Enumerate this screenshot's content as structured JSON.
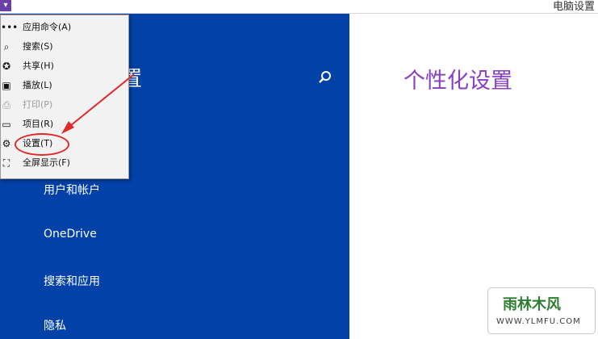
{
  "window": {
    "title": "电脑设置"
  },
  "left_pane": {
    "heading": "置",
    "items": [
      {
        "label": "用户和帐户"
      },
      {
        "label": "OneDrive"
      },
      {
        "label": "搜索和应用"
      },
      {
        "label": "隐私"
      }
    ]
  },
  "main": {
    "page_title": "个性化设置"
  },
  "context_menu": {
    "items": [
      {
        "label": "应用命令(A)",
        "icon": "more-icon",
        "enabled": true
      },
      {
        "label": "搜索(S)",
        "icon": "search-icon",
        "enabled": true
      },
      {
        "label": "共享(H)",
        "icon": "share-icon",
        "enabled": true
      },
      {
        "label": "播放(L)",
        "icon": "play-icon",
        "enabled": true
      },
      {
        "label": "打印(P)",
        "icon": "print-icon",
        "enabled": false
      },
      {
        "label": "项目(R)",
        "icon": "project-icon",
        "enabled": true
      },
      {
        "label": "设置(T)",
        "icon": "gear-icon",
        "enabled": true,
        "highlighted": true
      },
      {
        "label": "全屏显示(F)",
        "icon": "fullscreen-icon",
        "enabled": true
      }
    ]
  },
  "watermark": {
    "logo": "雨林木风",
    "url": "WWW.YLMFU.COM"
  },
  "colors": {
    "pane_blue": "#0242a8",
    "title_purple": "#8a3ec2",
    "annotation_red": "#e02828"
  }
}
